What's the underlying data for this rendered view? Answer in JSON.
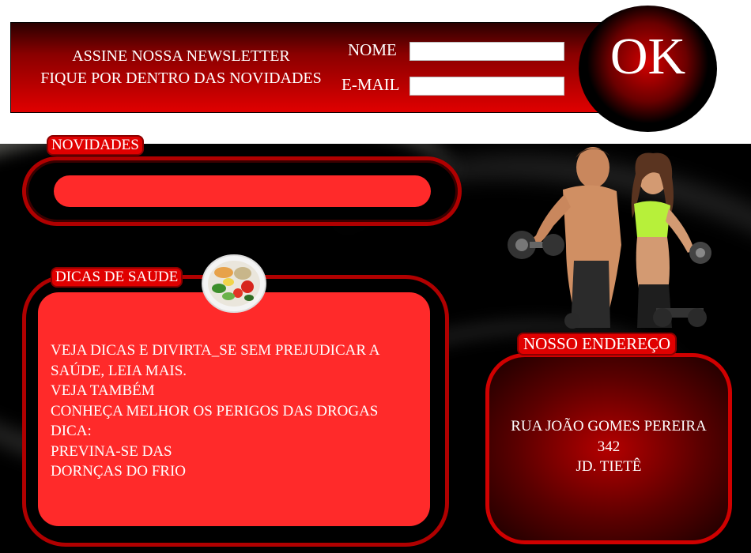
{
  "newsletter": {
    "title_line1": "ASSINE NOSSA NEWSLETTER",
    "title_line2": "FIQUE POR DENTRO DAS NOVIDADES",
    "nome_label": "NOME",
    "nome_value": "",
    "email_label": "E-MAIL",
    "email_value": "",
    "ok_label": "OK"
  },
  "novidades": {
    "label": "NOVIDADES"
  },
  "dicas": {
    "label": "DICAS DE SAUDE",
    "icon": "salad-bowl-icon",
    "lines": [
      "VEJA DICAS E DIVIRTA_SE SEM PREJUDICAR A",
      "SAÚDE, LEIA MAIS.",
      "VEJA TAMBÉM",
      "CONHEÇA MELHOR OS PERIGOS DAS DROGAS",
      "DICA:",
      "PREVINA-SE DAS",
      "DORNÇAS DO FRIO"
    ]
  },
  "endereco": {
    "label": "NOSSO ENDEREÇO",
    "street": "RUA JOÃO GOMES PEREIRA",
    "number": "342",
    "district": "JD. TIETÊ"
  },
  "hero_image": "athletes-with-dumbbells",
  "colors": {
    "accent_red": "#ff2a2a",
    "dark_red": "#b00000",
    "background": "#000000"
  }
}
